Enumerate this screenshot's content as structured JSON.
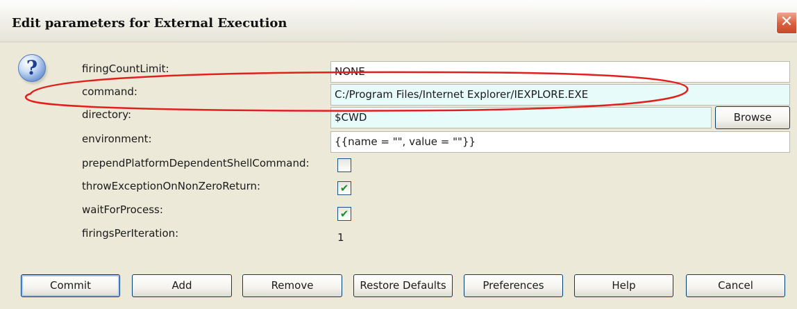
{
  "window": {
    "title": "Edit parameters for External Execution",
    "close_glyph": "✕"
  },
  "icon": {
    "name": "question-icon",
    "glyph": "?"
  },
  "params": {
    "firingCountLimit": {
      "label": "firingCountLimit:",
      "value": "NONE"
    },
    "command": {
      "label": "command:",
      "value": "C:/Program Files/Internet Explorer/IEXPLORE.EXE"
    },
    "directory": {
      "label": "directory:",
      "value": "$CWD"
    },
    "environment": {
      "label": "environment:",
      "value": "{{name = \"\", value = \"\"}}"
    },
    "prependPlatformDependentShellCommand": {
      "label": "prependPlatformDependentShellCommand:",
      "checked": false,
      "glyph": ""
    },
    "throwExceptionOnNonZeroReturn": {
      "label": "throwExceptionOnNonZeroReturn:",
      "checked": true,
      "glyph": "✔"
    },
    "waitForProcess": {
      "label": "waitForProcess:",
      "checked": true,
      "glyph": "✔"
    },
    "firingsPerIteration": {
      "label": "firingsPerIteration:",
      "value": "1"
    }
  },
  "browse_label": "Browse",
  "buttons": {
    "commit": "Commit",
    "add": "Add",
    "remove": "Remove",
    "restore": "Restore Defaults",
    "preferences": "Preferences",
    "help": "Help",
    "cancel": "Cancel"
  },
  "colors": {
    "dialog_bg": "#ece9d8",
    "field_highlight": "#e8fbfb",
    "annotation": "#e0201c",
    "close_button": "#d95f3d"
  }
}
